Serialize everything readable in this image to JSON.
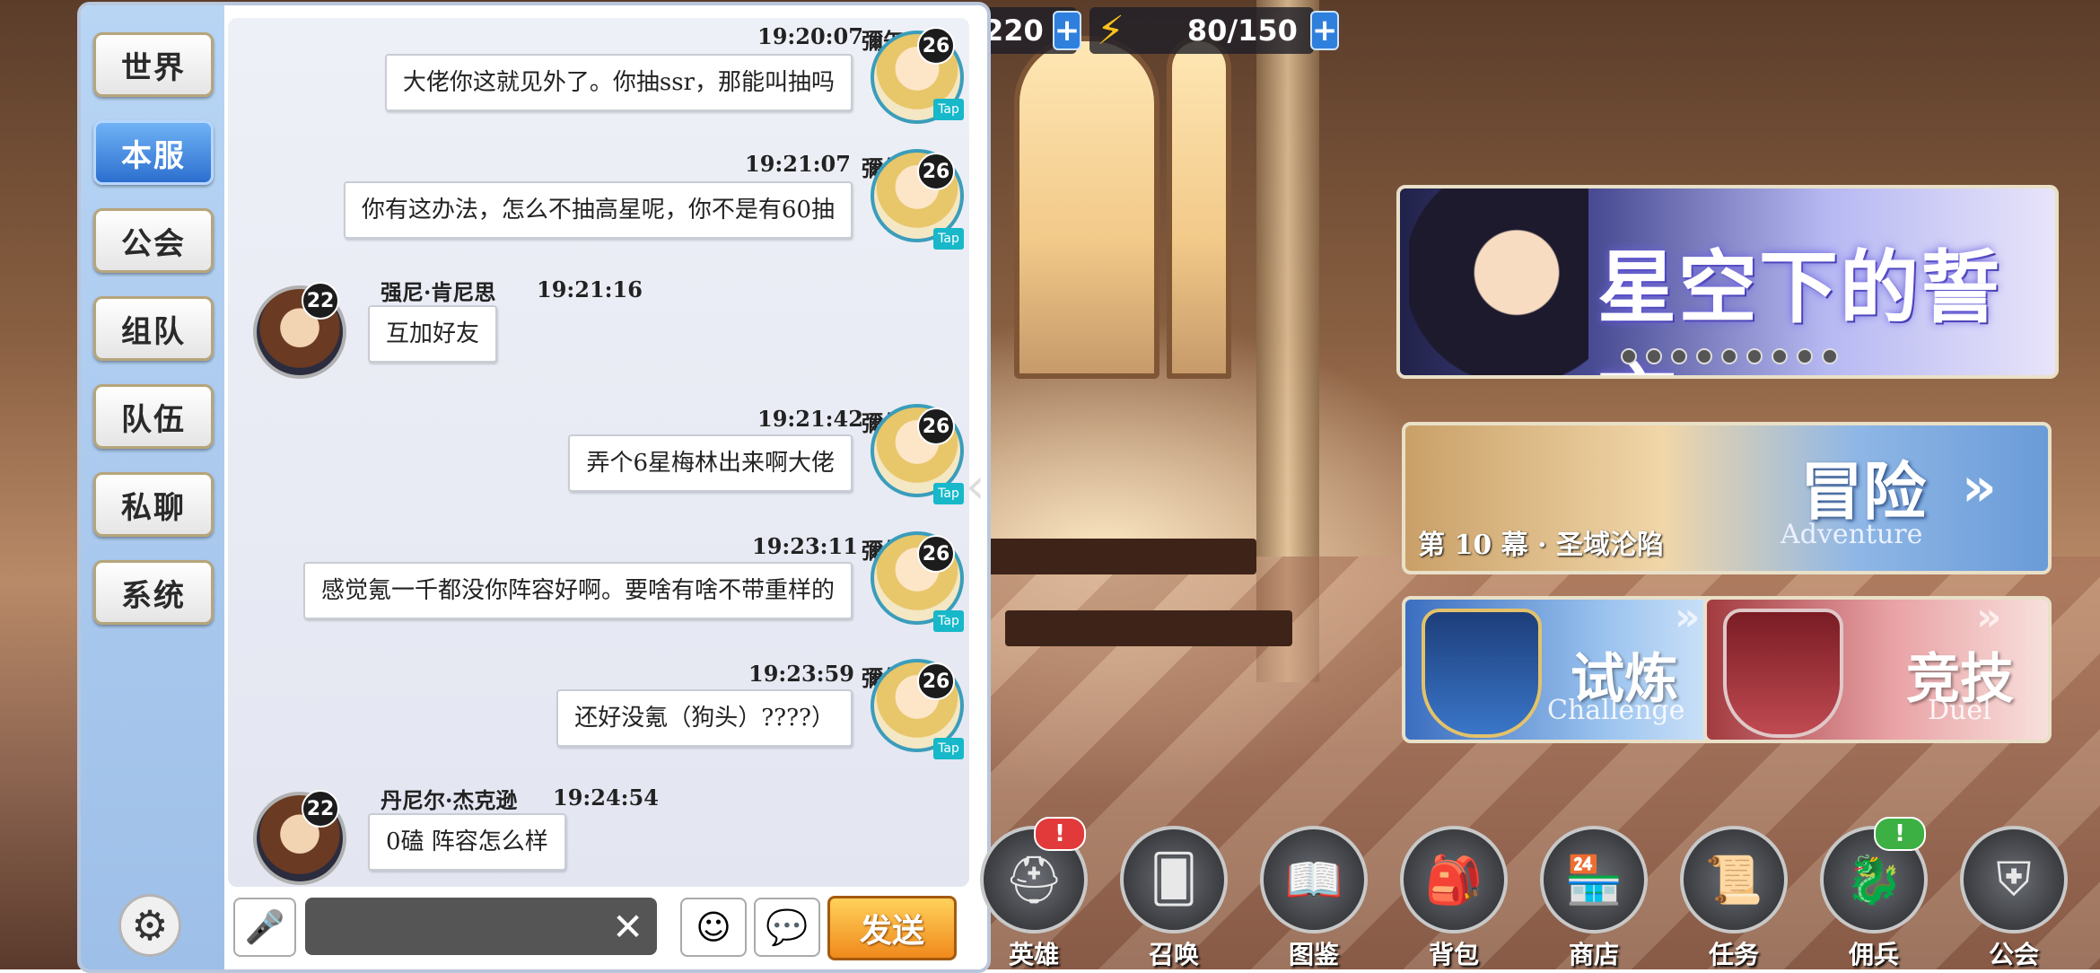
{
  "resources": {
    "currency_value": "220",
    "stamina_value": "80/150"
  },
  "chat": {
    "channels": [
      "世界",
      "本服",
      "公会",
      "组队",
      "队伍",
      "私聊",
      "系统"
    ],
    "active_channel": "本服",
    "messages": [
      {
        "name": "彌矢",
        "time": "19:20:07",
        "text": "大佬你这就见外了。你抽ssr，那能叫抽吗",
        "level": "26",
        "self": true
      },
      {
        "name": "彌矢",
        "time": "19:21:07",
        "text": "你有这办法，怎么不抽高星呢，你不是有60抽",
        "level": "26",
        "self": true
      },
      {
        "name": "强尼·肯尼思",
        "time": "19:21:16",
        "text": "互加好友",
        "level": "22",
        "self": false
      },
      {
        "name": "彌矢",
        "time": "19:21:42",
        "text": "弄个6星梅林出来啊大佬",
        "level": "26",
        "self": true
      },
      {
        "name": "彌矢",
        "time": "19:23:11",
        "text": "感觉氪一千都没你阵容好啊。要啥有啥不带重样的",
        "level": "26",
        "self": true
      },
      {
        "name": "彌矢",
        "time": "19:23:59",
        "text": "还好没氪（狗头）????）",
        "level": "26",
        "self": true
      },
      {
        "name": "丹尼尔·杰克逊",
        "time": "19:24:54",
        "text": "0磕  阵容怎么样",
        "level": "22",
        "self": false
      }
    ],
    "tap_label": "Tap",
    "send_label": "发送",
    "input_value": ""
  },
  "banners": {
    "event_title": "星空下的誓言",
    "adventure_title": "冒险",
    "adventure_en": "Adventure",
    "adventure_stage": "第 10 幕 · 圣域沦陷",
    "challenge_title": "试炼",
    "challenge_en": "Challenge",
    "duel_title": "竞技",
    "duel_en": "Duel"
  },
  "bottom_nav": [
    {
      "label": "英雄",
      "icon": "helmet-icon",
      "badge": "!",
      "badge_color": "#e23a3a"
    },
    {
      "label": "召唤",
      "icon": "cards-icon",
      "badge": "",
      "badge_color": ""
    },
    {
      "label": "图鉴",
      "icon": "book-icon",
      "badge": "",
      "badge_color": ""
    },
    {
      "label": "背包",
      "icon": "backpack-icon",
      "badge": "",
      "badge_color": ""
    },
    {
      "label": "商店",
      "icon": "shop-icon",
      "badge": "",
      "badge_color": ""
    },
    {
      "label": "任务",
      "icon": "quest-icon",
      "badge": "",
      "badge_color": ""
    },
    {
      "label": "佣兵",
      "icon": "mercenary-icon",
      "badge": "!",
      "badge_color": "#3cb043"
    },
    {
      "label": "公会",
      "icon": "guild-icon",
      "badge": "",
      "badge_color": ""
    }
  ]
}
